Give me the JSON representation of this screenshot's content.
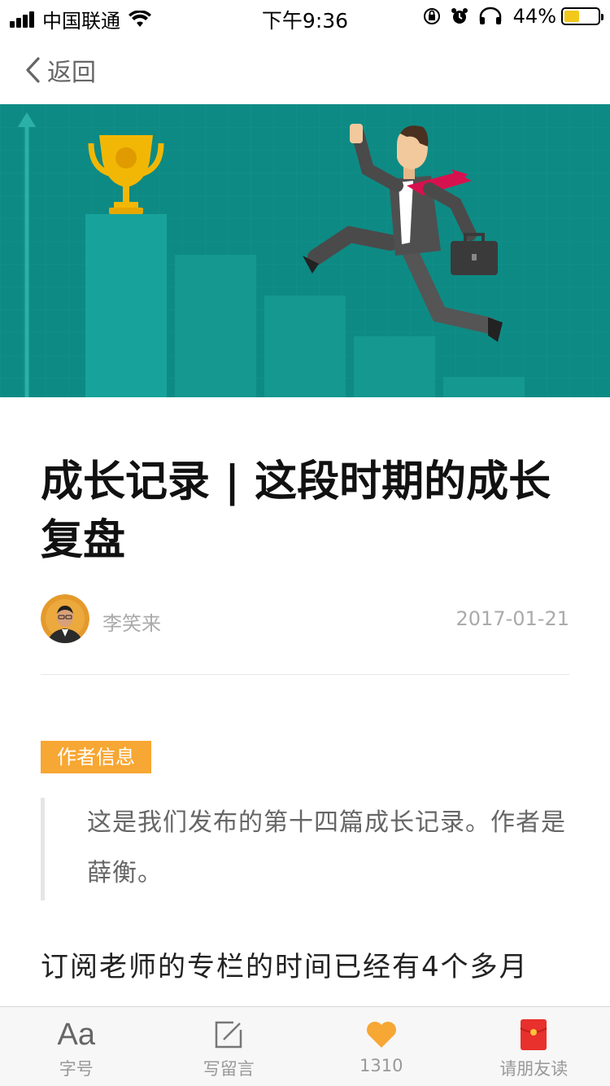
{
  "status_bar": {
    "carrier": "中国联通",
    "time": "下午9:36",
    "battery_percent": "44%",
    "battery_level": 0.44,
    "battery_color": "#f2c81b",
    "icons": [
      "signal-icon",
      "wifi-icon",
      "rotation-lock-icon",
      "alarm-icon",
      "headphones-icon",
      "battery-icon"
    ]
  },
  "nav": {
    "back_label": "返回"
  },
  "article": {
    "title": "成长记录 | 这段时期的成长复盘",
    "author": "李笑来",
    "date": "2017-01-21",
    "tag": "作者信息",
    "tag_color": "#f7a733",
    "quote": "这是我们发布的第十四篇成长记录。作者是薛衡。",
    "paragraph": "订阅老师的专栏的时间已经有4个多月"
  },
  "toolbar": {
    "font_icon_text": "Aa",
    "font_label": "字号",
    "comment_label": "写留言",
    "like_count": "1310",
    "like_color": "#f7a733",
    "share_label": "请朋友读",
    "share_color": "#e8302c"
  }
}
